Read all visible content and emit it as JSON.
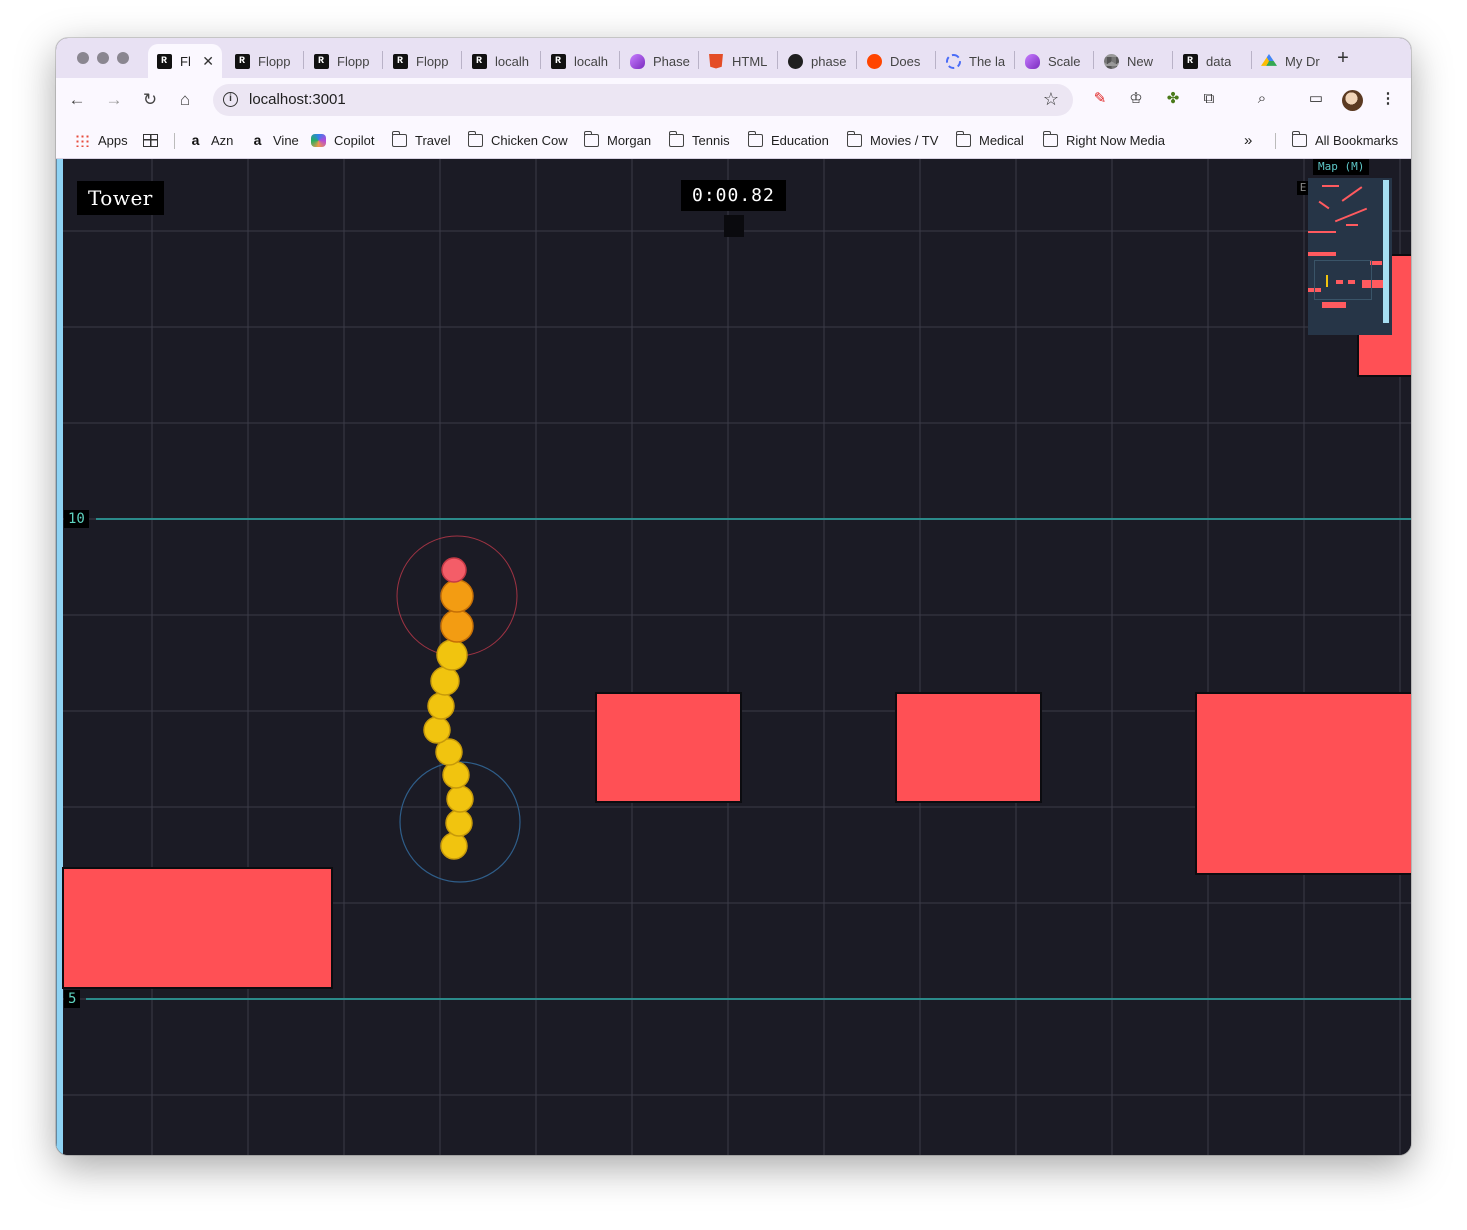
{
  "browser": {
    "tabs": [
      {
        "title": "Fl",
        "favicon": "r-logo-icon",
        "active": true
      },
      {
        "title": "Flopp",
        "favicon": "r-logo-icon"
      },
      {
        "title": "Flopp",
        "favicon": "r-logo-icon"
      },
      {
        "title": "Flopp",
        "favicon": "r-logo-icon"
      },
      {
        "title": "localh",
        "favicon": "r-logo-icon"
      },
      {
        "title": "localh",
        "favicon": "r-logo-icon"
      },
      {
        "title": "Phase",
        "favicon": "phaser-icon"
      },
      {
        "title": "HTML",
        "favicon": "html5-icon"
      },
      {
        "title": "phase",
        "favicon": "github-icon"
      },
      {
        "title": "Does",
        "favicon": "reddit-icon"
      },
      {
        "title": "The la",
        "favicon": "ring-icon"
      },
      {
        "title": "Scale",
        "favicon": "phaser-icon"
      },
      {
        "title": "New",
        "favicon": "chrome-icon"
      },
      {
        "title": "data",
        "favicon": "r-logo-icon"
      },
      {
        "title": "My Dr",
        "favicon": "drive-icon"
      }
    ],
    "new_tab": "+",
    "tab_close": "✕",
    "url": "localhost:3001"
  },
  "bookmarks": {
    "items": [
      {
        "label": "Apps",
        "icon": "apps-grid-icon"
      },
      {
        "label": "",
        "icon": "tab-groups-icon"
      },
      {
        "label": "Azn",
        "icon": "amazon-icon"
      },
      {
        "label": "Vine",
        "icon": "amazon-icon"
      },
      {
        "label": "Copilot",
        "icon": "copilot-icon"
      },
      {
        "label": "Travel",
        "icon": "folder-icon"
      },
      {
        "label": "Chicken Cow",
        "icon": "folder-icon"
      },
      {
        "label": "Morgan",
        "icon": "folder-icon"
      },
      {
        "label": "Tennis",
        "icon": "folder-icon"
      },
      {
        "label": "Education",
        "icon": "folder-icon"
      },
      {
        "label": "Movies / TV",
        "icon": "folder-icon"
      },
      {
        "label": "Medical",
        "icon": "folder-icon"
      },
      {
        "label": "Right Now Media",
        "icon": "folder-icon"
      }
    ],
    "overflow": "»",
    "all_bookmarks": "All Bookmarks"
  },
  "game": {
    "level_name": "Tower",
    "timer": "0:00.82",
    "map_label": "Map (M)",
    "map_edge_char": "E",
    "height_markers": [
      {
        "label": "10",
        "height": 10
      },
      {
        "label": "5",
        "height": 5
      }
    ],
    "colors": {
      "background": "#1b1b25",
      "grid": "#3b3b48",
      "marker_line": "#2b8a8a",
      "platform": "#ff5055",
      "rope_head": "#f45d68",
      "rope_orange": "#f39c12",
      "rope_yellow": "#f1c40f",
      "minimap_bg": "#263547",
      "left_wall": "#8fd3f4"
    }
  }
}
